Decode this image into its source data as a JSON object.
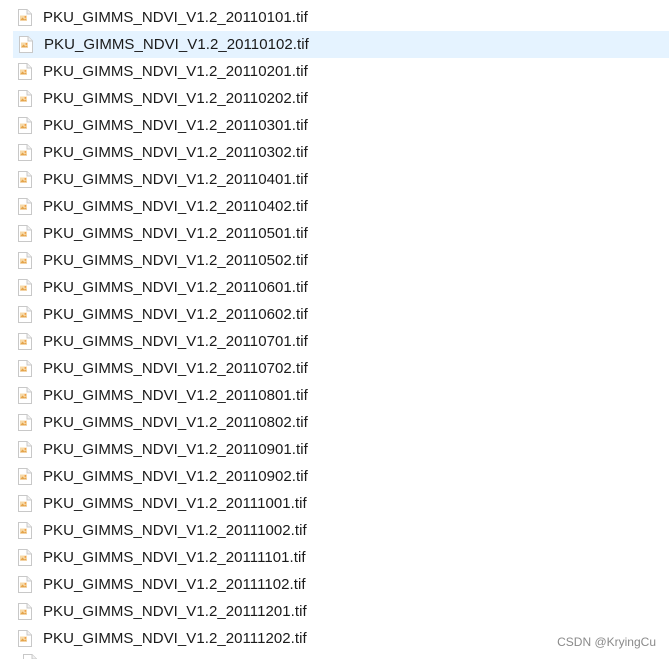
{
  "files": [
    {
      "name": "PKU_GIMMS_NDVI_V1.2_20110101.tif",
      "selected": false
    },
    {
      "name": "PKU_GIMMS_NDVI_V1.2_20110102.tif",
      "selected": true
    },
    {
      "name": "PKU_GIMMS_NDVI_V1.2_20110201.tif",
      "selected": false
    },
    {
      "name": "PKU_GIMMS_NDVI_V1.2_20110202.tif",
      "selected": false
    },
    {
      "name": "PKU_GIMMS_NDVI_V1.2_20110301.tif",
      "selected": false
    },
    {
      "name": "PKU_GIMMS_NDVI_V1.2_20110302.tif",
      "selected": false
    },
    {
      "name": "PKU_GIMMS_NDVI_V1.2_20110401.tif",
      "selected": false
    },
    {
      "name": "PKU_GIMMS_NDVI_V1.2_20110402.tif",
      "selected": false
    },
    {
      "name": "PKU_GIMMS_NDVI_V1.2_20110501.tif",
      "selected": false
    },
    {
      "name": "PKU_GIMMS_NDVI_V1.2_20110502.tif",
      "selected": false
    },
    {
      "name": "PKU_GIMMS_NDVI_V1.2_20110601.tif",
      "selected": false
    },
    {
      "name": "PKU_GIMMS_NDVI_V1.2_20110602.tif",
      "selected": false
    },
    {
      "name": "PKU_GIMMS_NDVI_V1.2_20110701.tif",
      "selected": false
    },
    {
      "name": "PKU_GIMMS_NDVI_V1.2_20110702.tif",
      "selected": false
    },
    {
      "name": "PKU_GIMMS_NDVI_V1.2_20110801.tif",
      "selected": false
    },
    {
      "name": "PKU_GIMMS_NDVI_V1.2_20110802.tif",
      "selected": false
    },
    {
      "name": "PKU_GIMMS_NDVI_V1.2_20110901.tif",
      "selected": false
    },
    {
      "name": "PKU_GIMMS_NDVI_V1.2_20110902.tif",
      "selected": false
    },
    {
      "name": "PKU_GIMMS_NDVI_V1.2_20111001.tif",
      "selected": false
    },
    {
      "name": "PKU_GIMMS_NDVI_V1.2_20111002.tif",
      "selected": false
    },
    {
      "name": "PKU_GIMMS_NDVI_V1.2_20111101.tif",
      "selected": false
    },
    {
      "name": "PKU_GIMMS_NDVI_V1.2_20111102.tif",
      "selected": false
    },
    {
      "name": "PKU_GIMMS_NDVI_V1.2_20111201.tif",
      "selected": false
    },
    {
      "name": "PKU_GIMMS_NDVI_V1.2_20111202.tif",
      "selected": false
    }
  ],
  "file_icon": "tif-file-icon",
  "colors": {
    "selection": "#e5f3ff",
    "text": "#1a1a1a",
    "watermark": "#8a8a8a"
  },
  "watermark": "CSDN @KryingCu"
}
